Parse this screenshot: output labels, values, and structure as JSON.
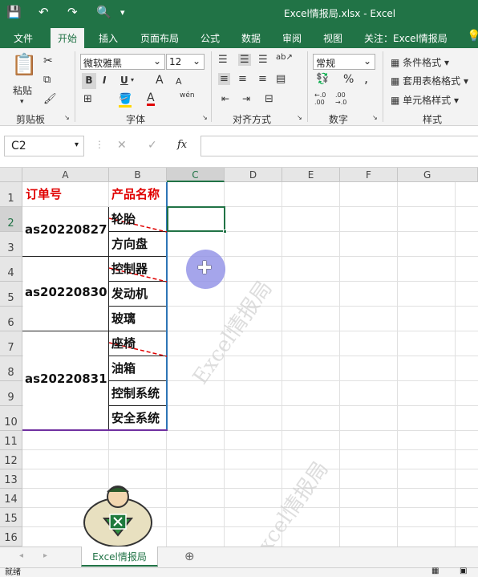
{
  "titlebar": {
    "title": "Excel情报局.xlsx  -  Excel"
  },
  "tabs": [
    "文件",
    "开始",
    "插入",
    "页面布局",
    "公式",
    "数据",
    "审阅",
    "视图",
    "关注：Excel情报局"
  ],
  "ribbon": {
    "clipboard": {
      "paste": "粘贴",
      "label": "剪贴板"
    },
    "font": {
      "name": "微软雅黑",
      "size": "12",
      "bold": "B",
      "italic": "I",
      "underline": "U",
      "grow": "A",
      "shrink": "A",
      "phonetic": "wén",
      "label": "字体"
    },
    "align": {
      "label": "对齐方式"
    },
    "number": {
      "format": "常规",
      "percent": "%",
      "comma": ",",
      "inc_dec": "←.0 .00",
      "dec_dec": ".00 →.0",
      "label": "数字"
    },
    "styles": {
      "cond": "条件格式",
      "table": "套用表格格式",
      "cell": "单元格样式",
      "label": "样式"
    }
  },
  "formula_bar": {
    "name_box": "C2",
    "fx": "fx",
    "content": ""
  },
  "columns": [
    "A",
    "B",
    "C",
    "D",
    "E",
    "F",
    "G"
  ],
  "rows": [
    "1",
    "2",
    "3",
    "4",
    "5",
    "6",
    "7",
    "8",
    "9",
    "10",
    "11",
    "12",
    "13",
    "14",
    "15",
    "16"
  ],
  "cells": {
    "a1": "订单号",
    "b1": "产品名称",
    "orders": [
      "as20220827",
      "as20220830",
      "as20220831"
    ],
    "products": [
      "轮胎",
      "方向盘",
      "控制器",
      "发动机",
      "玻璃",
      "座椅",
      "油箱",
      "控制系统",
      "安全系统"
    ]
  },
  "watermark": "Excel情报局",
  "sheet_tab": "Excel情报局",
  "status": "就绪"
}
